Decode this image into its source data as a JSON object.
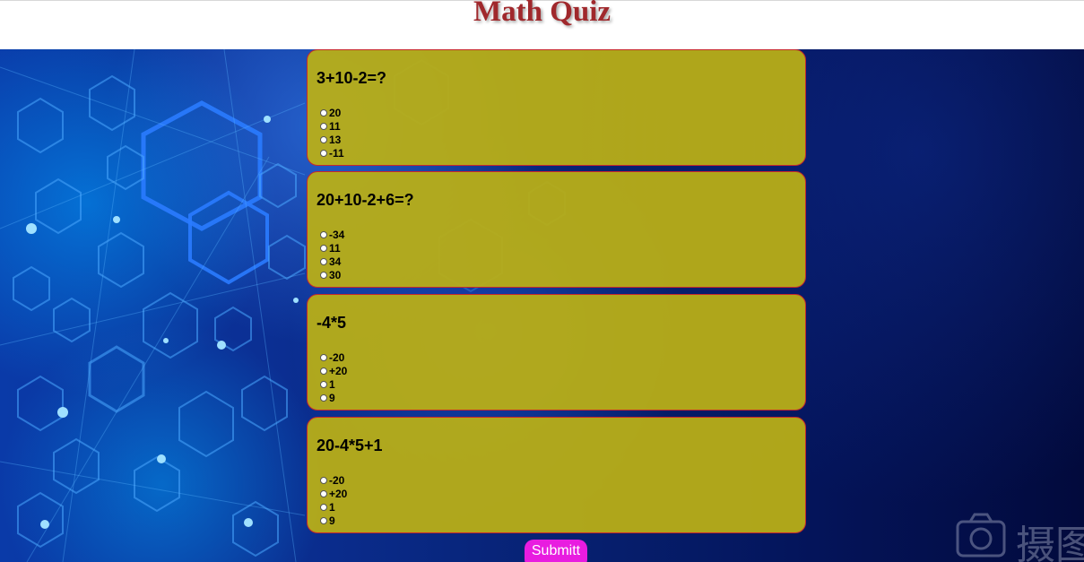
{
  "page": {
    "title": "Math Quiz",
    "submit_label": "Submitt"
  },
  "questions": [
    {
      "text": "3+10-2=?",
      "options": [
        "20",
        "11",
        "13",
        "-11"
      ]
    },
    {
      "text": "20+10-2+6=?",
      "options": [
        "-34",
        "11",
        "34",
        "30"
      ]
    },
    {
      "text": "-4*5",
      "options": [
        "-20",
        "+20",
        "1",
        "9"
      ]
    },
    {
      "text": "20-4*5+1",
      "options": [
        "-20",
        "+20",
        "1",
        "9"
      ]
    }
  ],
  "watermark": {
    "text": "摄图",
    "icon": "camera-icon"
  },
  "colors": {
    "title": "#a0282c",
    "card_background": "#baaf16",
    "card_border": "#c7282c",
    "submit_background": "#e81ce0",
    "page_background": "#0b2f93"
  }
}
